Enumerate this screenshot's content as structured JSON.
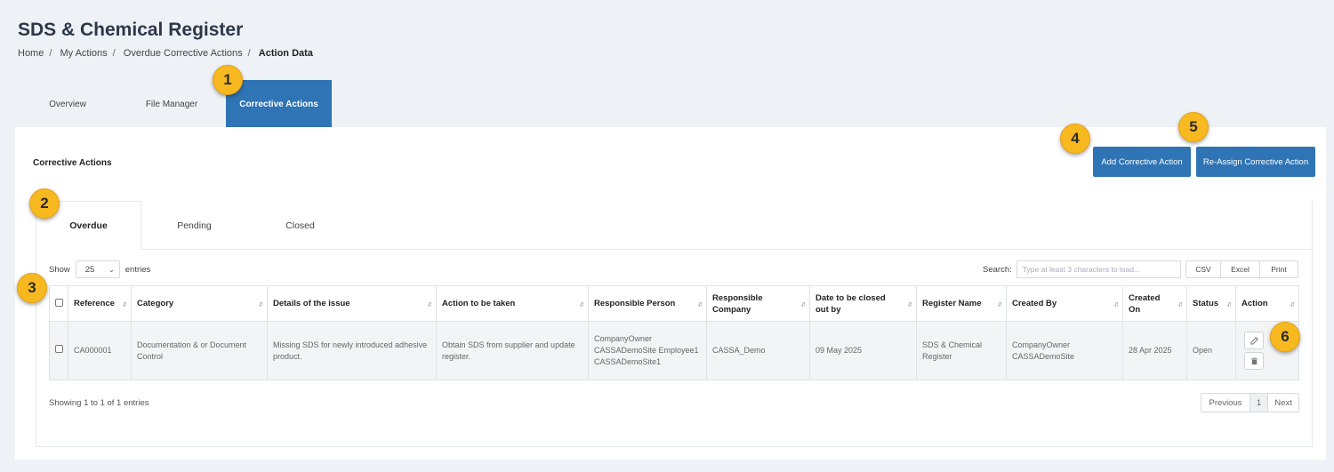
{
  "page": {
    "title": "SDS & Chemical Register",
    "breadcrumb": [
      "Home",
      "My Actions",
      "Overdue Corrective Actions",
      "Action Data"
    ]
  },
  "main_tabs": [
    "Overview",
    "File Manager",
    "Corrective Actions"
  ],
  "section": {
    "title": "Corrective Actions",
    "add_label": "Add Corrective Action",
    "reassign_label": "Re-Assign Corrective Action"
  },
  "sub_tabs": [
    "Overdue",
    "Pending",
    "Closed"
  ],
  "table_controls": {
    "show_label": "Show",
    "entries_value": "25",
    "entries_label": "entries",
    "search_label": "Search:",
    "search_placeholder": "Type at least 3 characters to load...",
    "export": [
      "CSV",
      "Excel",
      "Print"
    ]
  },
  "table": {
    "columns": [
      "Reference",
      "Category",
      "Details of the issue",
      "Action to be taken",
      "Responsible Person",
      "Responsible Company",
      "Date to be closed out by",
      "Register Name",
      "Created By",
      "Created On",
      "Status",
      "Action"
    ],
    "rows": [
      {
        "reference": "CA000001",
        "category": "Documentation & or Document Control",
        "details": "Missing SDS for newly introduced adhesive product.",
        "action": "Obtain SDS from supplier and update register.",
        "person": "CompanyOwner CASSADemoSite Employee1 CASSADemoSite1",
        "company": "CASSA_Demo",
        "date": "09 May 2025",
        "register": "SDS & Chemical Register",
        "created_by": "CompanyOwner CASSADemoSite",
        "created_on": "28 Apr 2025",
        "status": "Open"
      }
    ],
    "info": "Showing 1 to 1 of 1 entries",
    "pager": [
      "Previous",
      "1",
      "Next"
    ]
  },
  "annotations": [
    "1",
    "2",
    "3",
    "4",
    "5",
    "6"
  ],
  "colors": {
    "accent": "#2f74b5",
    "badge": "#f8b820",
    "background": "#eef2f6"
  },
  "icons": {
    "edit": "edit-icon",
    "delete": "trash-icon"
  }
}
